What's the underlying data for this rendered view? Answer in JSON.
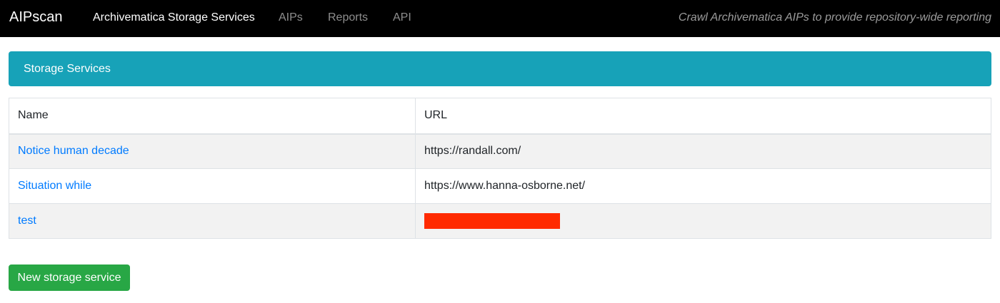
{
  "navbar": {
    "brand": "AIPscan",
    "links": [
      {
        "label": "Archivematica Storage Services",
        "active": true
      },
      {
        "label": "AIPs",
        "active": false
      },
      {
        "label": "Reports",
        "active": false
      },
      {
        "label": "API",
        "active": false
      }
    ],
    "tagline": "Crawl Archivematica AIPs to provide repository-wide reporting"
  },
  "section": {
    "title": "Storage Services",
    "accent_color": "#17a2b8"
  },
  "table": {
    "headers": [
      "Name",
      "URL"
    ],
    "rows": [
      {
        "name": "Notice human decade",
        "url": "https://randall.com/"
      },
      {
        "name": "Situation while",
        "url": "https://www.hanna-osborne.net/"
      },
      {
        "name": "test",
        "url": "",
        "url_redacted": true
      }
    ]
  },
  "actions": {
    "new_label": "New storage service",
    "new_color": "#28a745"
  },
  "colors": {
    "link": "#007bff",
    "redaction": "#ff2a00"
  }
}
